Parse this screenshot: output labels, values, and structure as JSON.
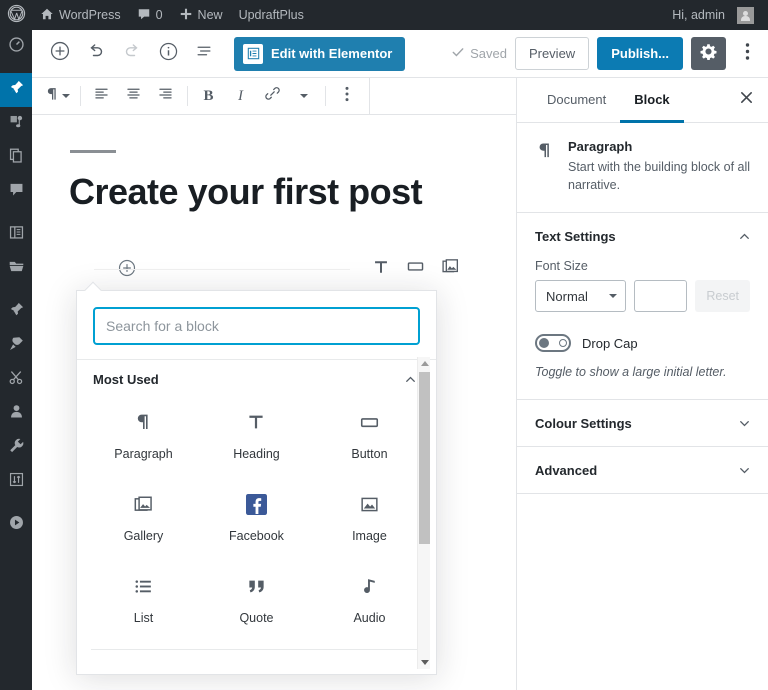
{
  "adminbar": {
    "logo_icon": "wordpress-logo-icon",
    "site_icon": "home-icon",
    "site_name": "WordPress",
    "comments_icon": "comment-bubble-icon",
    "comments_count": "0",
    "new_icon": "plus-icon",
    "new_label": "New",
    "plugin_label": "UpdraftPlus",
    "greeting": "Hi, admin",
    "avatar_icon": "user-avatar-icon"
  },
  "adminmenu": {
    "items": [
      {
        "icon": "dashboard-gauge-icon",
        "name": "dashboard"
      },
      {
        "icon": "pin-posts-icon",
        "name": "posts",
        "current": true
      },
      {
        "icon": "media-icon",
        "name": "media"
      },
      {
        "icon": "pages-icon",
        "name": "pages"
      },
      {
        "icon": "comments-icon",
        "name": "comments"
      },
      {
        "icon": "appearance-icon",
        "name": "appearance"
      },
      {
        "icon": "plugins-folder-icon",
        "name": "plugins-folder"
      },
      {
        "icon": "pin-icon",
        "name": "pinned"
      },
      {
        "icon": "plug-icon",
        "name": "plugins"
      },
      {
        "icon": "scissors-icon",
        "name": "scissors"
      },
      {
        "icon": "users-icon",
        "name": "users"
      },
      {
        "icon": "wrench-tools-icon",
        "name": "tools"
      },
      {
        "icon": "settings-arrows-icon",
        "name": "settings"
      },
      {
        "icon": "play-circle-icon",
        "name": "media-player"
      }
    ]
  },
  "header": {
    "add_block_icon": "plus-circle-icon",
    "undo_icon": "undo-arrow-icon",
    "redo_icon": "redo-arrow-icon",
    "info_icon": "info-circle-icon",
    "list_view_icon": "block-navigation-icon",
    "elementor_label": "Edit with Elementor",
    "elementor_icon": "elementor-document-icon",
    "elementor_color": "#1f7faf",
    "saved_label": "Saved",
    "saved_icon": "check-icon",
    "preview_label": "Preview",
    "publish_label": "Publish...",
    "publish_color": "#0c7bb3",
    "settings_icon": "gear-icon",
    "more_icon": "kebab-menu-icon"
  },
  "block_toolbar": {
    "block_type_icon": "paragraph-pilcrow-icon",
    "align_left_icon": "align-left-icon",
    "align_center_icon": "align-center-icon",
    "align_right_icon": "align-right-icon",
    "bold_label": "B",
    "italic_label": "I",
    "link_icon": "link-chain-icon",
    "more_formatting_icon": "chevron-down-icon",
    "more_options_icon": "kebab-menu-icon"
  },
  "canvas": {
    "post_title": "Create your first post",
    "inserter_icon": "plus-circle-icon",
    "quick_inserts": [
      {
        "icon": "heading-T-icon",
        "name": "heading"
      },
      {
        "icon": "button-rect-icon",
        "name": "button"
      },
      {
        "icon": "gallery-icon",
        "name": "gallery"
      }
    ]
  },
  "inserter": {
    "search_placeholder": "Search for a block",
    "search_value": "",
    "section_title": "Most Used",
    "section_chevron": "chevron-up-icon",
    "blocks": [
      {
        "label": "Paragraph",
        "icon": "paragraph-pilcrow-icon"
      },
      {
        "label": "Heading",
        "icon": "heading-T-icon"
      },
      {
        "label": "Button",
        "icon": "button-rect-icon"
      },
      {
        "label": "Gallery",
        "icon": "gallery-icon"
      },
      {
        "label": "Facebook",
        "icon": "facebook-icon"
      },
      {
        "label": "Image",
        "icon": "image-icon"
      },
      {
        "label": "List",
        "icon": "bulleted-list-icon"
      },
      {
        "label": "Quote",
        "icon": "quote-marks-icon"
      },
      {
        "label": "Audio",
        "icon": "music-note-icon"
      }
    ],
    "scroll_up_icon": "scroll-up-arrow",
    "scroll_down_icon": "scroll-down-arrow"
  },
  "sidebar": {
    "tab_document": "Document",
    "tab_block": "Block",
    "active_tab": "Block",
    "close_icon": "close-x-icon",
    "block_card": {
      "icon": "paragraph-pilcrow-icon",
      "title": "Paragraph",
      "description": "Start with the building block of all narrative."
    },
    "text_settings": {
      "title": "Text Settings",
      "chevron": "chevron-up-icon",
      "font_size_label": "Font Size",
      "font_size_value": "Normal",
      "font_size_custom": "",
      "reset_label": "Reset",
      "drop_cap_label": "Drop Cap",
      "drop_cap_state": "off",
      "drop_cap_help": "Toggle to show a large initial letter."
    },
    "colour_settings": {
      "title": "Colour Settings",
      "chevron": "chevron-down-icon"
    },
    "advanced": {
      "title": "Advanced",
      "chevron": "chevron-down-icon"
    }
  }
}
